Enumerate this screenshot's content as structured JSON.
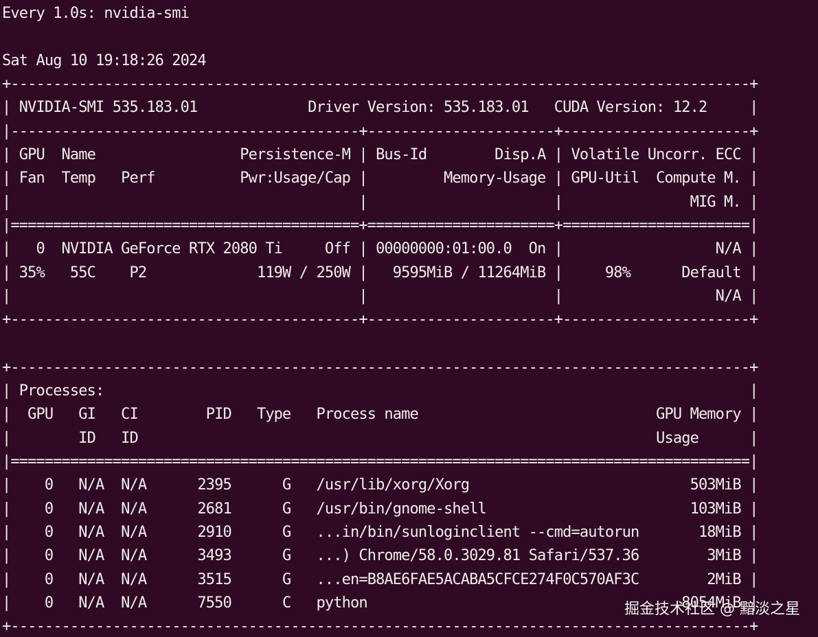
{
  "terminal": {
    "background": "#300a24",
    "foreground": "#eeeeec",
    "lines": [
      "Every 1.0s: nvidia-smi",
      "",
      "Sat Aug 10 19:18:26 2024",
      "+---------------------------------------------------------------------------------------+",
      "| NVIDIA-SMI 535.183.01             Driver Version: 535.183.01   CUDA Version: 12.2     |",
      "|-----------------------------------------+----------------------+----------------------+",
      "| GPU  Name                 Persistence-M | Bus-Id        Disp.A | Volatile Uncorr. ECC |",
      "| Fan  Temp   Perf          Pwr:Usage/Cap |         Memory-Usage | GPU-Util  Compute M. |",
      "|                                         |                      |               MIG M. |",
      "|=========================================+======================+======================|",
      "|   0  NVIDIA GeForce RTX 2080 Ti     Off | 00000000:01:00.0  On |                  N/A |",
      "| 35%   55C    P2             119W / 250W |   9595MiB / 11264MiB |     98%      Default |",
      "|                                         |                      |                  N/A |",
      "+-----------------------------------------+----------------------+----------------------+",
      "",
      "",
      "+---------------------------------------------------------------------------------------+",
      "| Processes:                                                                            |",
      "|  GPU   GI   CI        PID   Type   Process name                            GPU Memory |",
      "|        ID   ID                                                             Usage      |",
      "|=======================================================================================|",
      "|    0   N/A  N/A      2395      G   /usr/lib/xorg/Xorg                          503MiB |",
      "|    0   N/A  N/A      2681      G   /usr/bin/gnome-shell                        103MiB |",
      "|    0   N/A  N/A      2910      G   ...in/bin/sunloginclient --cmd=autorun       18MiB |",
      "|    0   N/A  N/A      3493      G   ...) Chrome/58.0.3029.81 Safari/537.36        3MiB |",
      "|    0   N/A  N/A      3515      G   ...en=B8AE6FAE5ACABA5CFCE274F0C570AF3C        2MiB |",
      "|    0   N/A  N/A      7550      C   python                                     8054MiB |",
      "+---------------------------------------------------------------------------------------+"
    ]
  },
  "watermark": {
    "text": "掘金技术社区 @ 黯淡之星"
  }
}
